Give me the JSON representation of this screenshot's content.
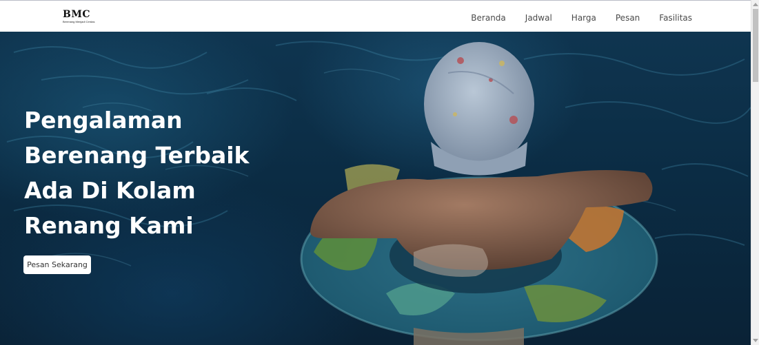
{
  "navbar": {
    "brand_mark": "BMC",
    "brand_tagline": "Berenang Menjadi Cerdas",
    "links": [
      "Beranda",
      "Jadwal",
      "Harga",
      "Pesan",
      "Fasilitas"
    ]
  },
  "hero": {
    "headline_lines": [
      "Pengalaman",
      "Berenang Terbaik",
      "Ada Di Kolam",
      "Renang Kami"
    ],
    "cta_label": "Pesan Sekarang",
    "image_subject": "child-in-swim-cap-with-inflatable-ring-in-pool"
  },
  "colors": {
    "navbar_bg": "#ffffff",
    "nav_text": "#4a4a4a",
    "hero_overlay": "#0b2c44",
    "headline_text": "#ffffff",
    "cta_bg": "#ffffff"
  }
}
